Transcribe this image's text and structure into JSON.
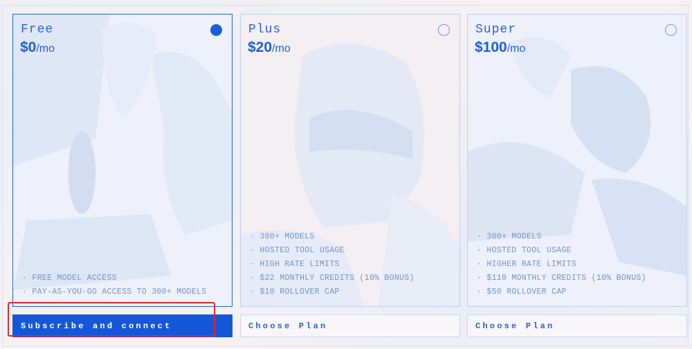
{
  "plans": [
    {
      "name": "Free",
      "price": "$0",
      "unit": "/mo",
      "selected": true,
      "features": [
        "FREE MODEL ACCESS",
        "PAY-AS-YOU-GO ACCESS TO 300+ MODELS"
      ],
      "cta": "Subscribe and connect"
    },
    {
      "name": "Plus",
      "price": "$20",
      "unit": "/mo",
      "selected": false,
      "features": [
        "300+ MODELS",
        "HOSTED TOOL USAGE",
        "HIGH RATE LIMITS",
        "$22 MONTHLY CREDITS (10% BONUS)",
        "$10 ROLLOVER CAP"
      ],
      "cta": "Choose Plan"
    },
    {
      "name": "Super",
      "price": "$100",
      "unit": "/mo",
      "selected": false,
      "features": [
        "300+ MODELS",
        "HOSTED TOOL USAGE",
        "HIGHER RATE LIMITS",
        "$110 MONTHLY CREDITS (10% BONUS)",
        "$50 ROLLOVER CAP"
      ],
      "cta": "Choose Plan"
    }
  ],
  "colors": {
    "accent": "#1457d9",
    "text": "#2a63d4",
    "muted": "#7393d0",
    "highlight": "#e0262f"
  }
}
